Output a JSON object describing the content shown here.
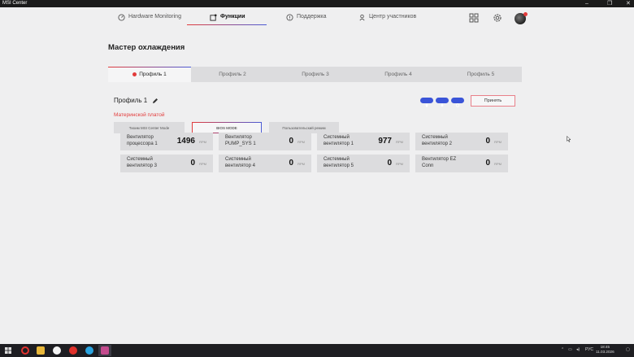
{
  "window": {
    "title": "MSI Center",
    "minimize": "–",
    "maximize": "❐",
    "close": "✕"
  },
  "nav": {
    "items": [
      {
        "label": "Hardware Monitoring"
      },
      {
        "label": "Функции"
      },
      {
        "label": "Поддержка"
      },
      {
        "label": "Центр участников"
      }
    ]
  },
  "page": {
    "title": "Мастер охлаждения"
  },
  "tabs": [
    "Профиль 1",
    "Профиль 2",
    "Профиль 3",
    "Профиль 4",
    "Профиль 5"
  ],
  "profile": {
    "name": "Профиль 1",
    "apply_label": "Принять"
  },
  "section_label": "Материнской платой",
  "modes": [
    "Тихим MSI Center Mode",
    "BIOS MODE",
    "Пользовательский режим"
  ],
  "fans": [
    {
      "label": "Вентилятор процессора 1",
      "value": "1496",
      "unit": "RPM"
    },
    {
      "label": "Вентилятор PUMP_SYS 1",
      "value": "0",
      "unit": "RPM"
    },
    {
      "label": "Системный вентилятор 1",
      "value": "977",
      "unit": "RPM"
    },
    {
      "label": "Системный вентилятор 2",
      "value": "0",
      "unit": "RPM"
    },
    {
      "label": "Системный вентилятор 3",
      "value": "0",
      "unit": "RPM"
    },
    {
      "label": "Системный вентилятор 4",
      "value": "0",
      "unit": "RPM"
    },
    {
      "label": "Системный вентилятор 5",
      "value": "0",
      "unit": "RPM"
    },
    {
      "label": "Вентилятор EZ Conn",
      "value": "0",
      "unit": "RPM"
    }
  ],
  "taskbar": {
    "lang": "РУС",
    "time": "18:45",
    "date": "11.03.2026"
  },
  "colors": {
    "accent_red": "#e23b3b",
    "accent_blue": "#3a54d8"
  }
}
